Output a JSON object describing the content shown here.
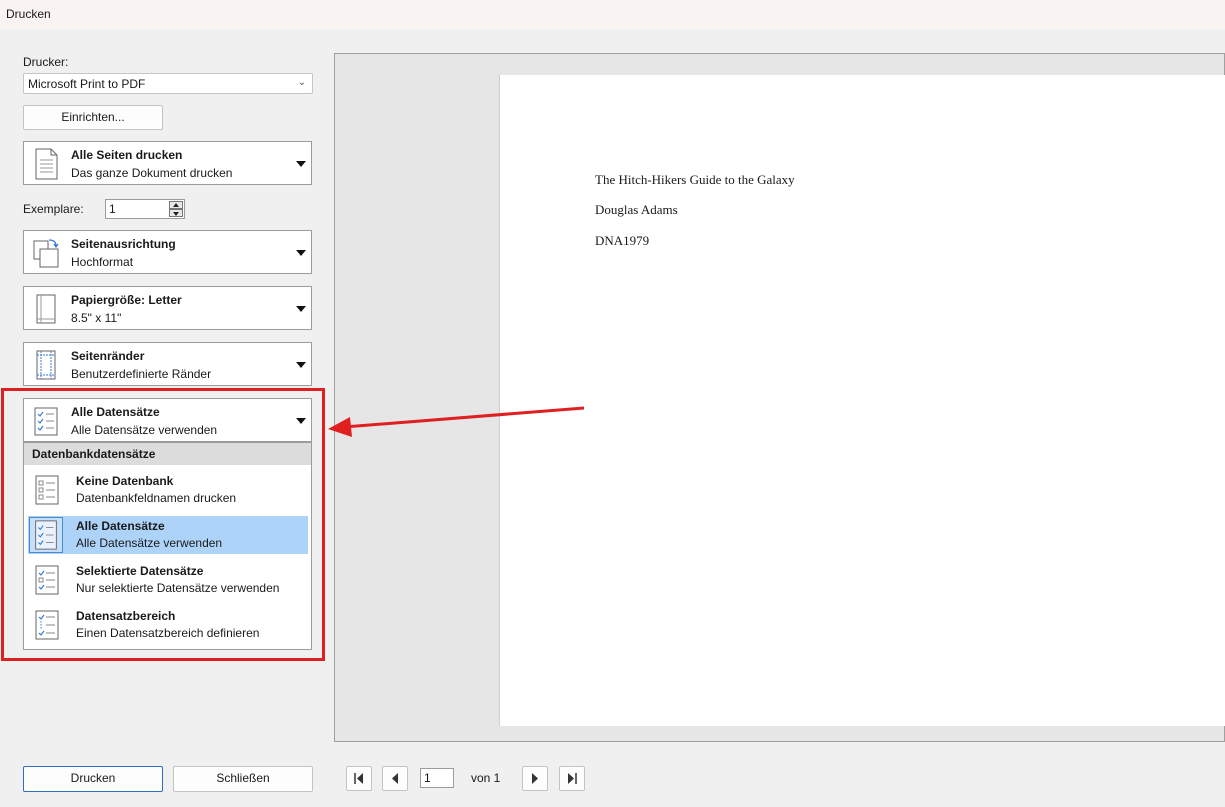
{
  "window": {
    "title": "Drucken"
  },
  "printer": {
    "label": "Drucker:",
    "selected": "Microsoft Print to PDF",
    "setup_button": "Einrichten..."
  },
  "pages_setting": {
    "title": "Alle Seiten drucken",
    "subtitle": "Das ganze Dokument drucken"
  },
  "copies": {
    "label": "Exemplare:",
    "value": "1"
  },
  "orientation_setting": {
    "title": "Seitenausrichtung",
    "subtitle": "Hochformat"
  },
  "paper_setting": {
    "title": "Papiergröße: Letter",
    "subtitle": "8.5\" x 11\""
  },
  "margins_setting": {
    "title": "Seitenränder",
    "subtitle": "Benutzerdefinierte Ränder"
  },
  "records_setting": {
    "title": "Alle Datensätze",
    "subtitle": "Alle Datensätze verwenden"
  },
  "records_dropdown": {
    "header": "Datenbankdatensätze",
    "options": [
      {
        "title": "Keine Datenbank",
        "subtitle": "Datenbankfeldnamen drucken",
        "icon": "list-empty-icon"
      },
      {
        "title": "Alle Datensätze",
        "subtitle": "Alle Datensätze verwenden",
        "icon": "list-all-checked-icon",
        "selected": true
      },
      {
        "title": "Selektierte Datensätze",
        "subtitle": "Nur selektierte Datensätze verwenden",
        "icon": "list-some-checked-icon"
      },
      {
        "title": "Datensatzbereich",
        "subtitle": "Einen Datensatzbereich definieren",
        "icon": "list-range-icon"
      }
    ]
  },
  "preview": {
    "lines": [
      "The Hitch-Hikers Guide to the Galaxy",
      "Douglas Adams",
      "DNA1979"
    ]
  },
  "footer": {
    "print_button": "Drucken",
    "close_button": "Schließen",
    "current_page": "1",
    "page_total": "von 1"
  },
  "colors": {
    "annotation": "#e02020",
    "selected_option": "#aed3f9"
  }
}
